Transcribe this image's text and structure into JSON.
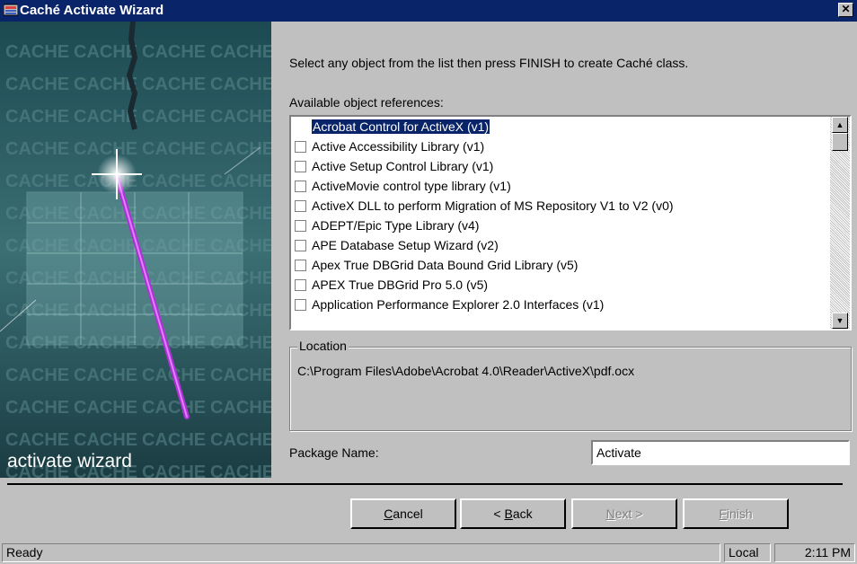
{
  "window": {
    "title": "Caché Activate Wizard",
    "close_icon": "close-icon"
  },
  "banner": {
    "label": "activate wizard",
    "tile_text": "CACHE"
  },
  "instructions": "Select any object from the list then press FINISH to create Caché class.",
  "available_label": "Available object references:",
  "list": {
    "items": [
      {
        "label": "Acrobat Control for ActiveX (v1)",
        "checked": false,
        "selected": true
      },
      {
        "label": "Active Accessibility Library (v1)",
        "checked": false
      },
      {
        "label": "Active Setup Control Library (v1)",
        "checked": false
      },
      {
        "label": "ActiveMovie control type library (v1)",
        "checked": false
      },
      {
        "label": "ActiveX DLL to perform Migration of MS Repository V1 to V2 (v0)",
        "checked": false
      },
      {
        "label": "ADEPT/Epic Type Library (v4)",
        "checked": false
      },
      {
        "label": "APE Database Setup Wizard (v2)",
        "checked": false
      },
      {
        "label": "Apex True DBGrid Data Bound Grid Library (v5)",
        "checked": false
      },
      {
        "label": "APEX True DBGrid Pro 5.0 (v5)",
        "checked": false
      },
      {
        "label": "Application Performance Explorer 2.0 Interfaces (v1)",
        "checked": false
      }
    ]
  },
  "location": {
    "legend": "Location",
    "value": "C:\\Program Files\\Adobe\\Acrobat 4.0\\Reader\\ActiveX\\pdf.ocx"
  },
  "package": {
    "label": "Package Name:",
    "value": "Activate"
  },
  "buttons": {
    "cancel": {
      "label": "Cancel",
      "accel": "C",
      "rest": "ancel"
    },
    "back": {
      "label": "< Back",
      "pre": "< ",
      "accel": "B",
      "rest": "ack"
    },
    "next": {
      "label": "Next >",
      "accel": "N",
      "rest": "ext >",
      "enabled": false
    },
    "finish": {
      "label": "Finish",
      "accel": "F",
      "rest": "inish",
      "enabled": false
    }
  },
  "status": {
    "text": "Ready",
    "zone": "Local",
    "time": "2:11 PM"
  },
  "colors": {
    "titlebar": "#0a246a",
    "face": "#c0c0c0",
    "selection": "#0a246a",
    "wand": "#a020c8"
  }
}
